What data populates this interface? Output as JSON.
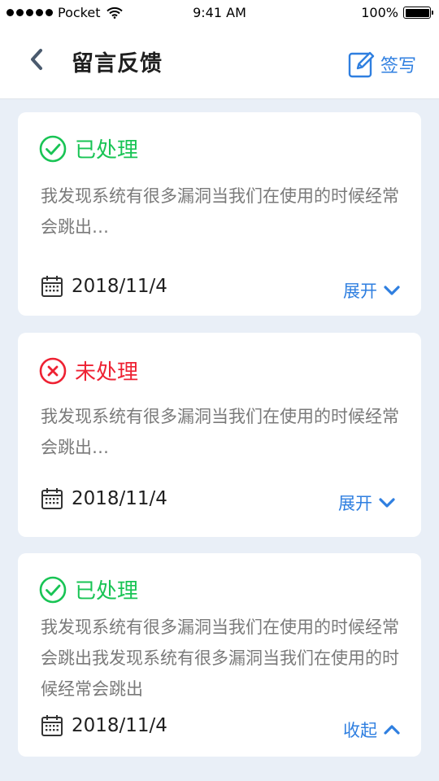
{
  "status_bar": {
    "carrier": "Pocket",
    "time": "9:41 AM",
    "battery": "100%",
    "battery_level": 1.0
  },
  "nav": {
    "title": "留言反馈",
    "write_label": "签写"
  },
  "colors": {
    "accent": "#2f7fe0",
    "done": "#19c455",
    "todo": "#ee2233",
    "page_bg": "#e9eff7"
  },
  "feedback": [
    {
      "status": "已处理",
      "status_icon": "check-circle-icon",
      "message": "我发现系统有很多漏洞当我们在使用的时候经常会跳出…",
      "date": "2018/11/4",
      "toggle_label": "展开",
      "toggle_icon": "chevron-down-icon"
    },
    {
      "status": "未处理",
      "status_icon": "x-circle-icon",
      "message": "我发现系统有很多漏洞当我们在使用的时候经常会跳出…",
      "date": "2018/11/4",
      "toggle_label": "展开",
      "toggle_icon": "chevron-down-icon"
    },
    {
      "status": "已处理",
      "status_icon": "check-circle-icon",
      "message": "我发现系统有很多漏洞当我们在使用的时候经常会跳出我发现系统有很多漏洞当我们在使用的时候经常会跳出",
      "date": "2018/11/4",
      "toggle_label": "收起",
      "toggle_icon": "chevron-up-icon"
    }
  ]
}
